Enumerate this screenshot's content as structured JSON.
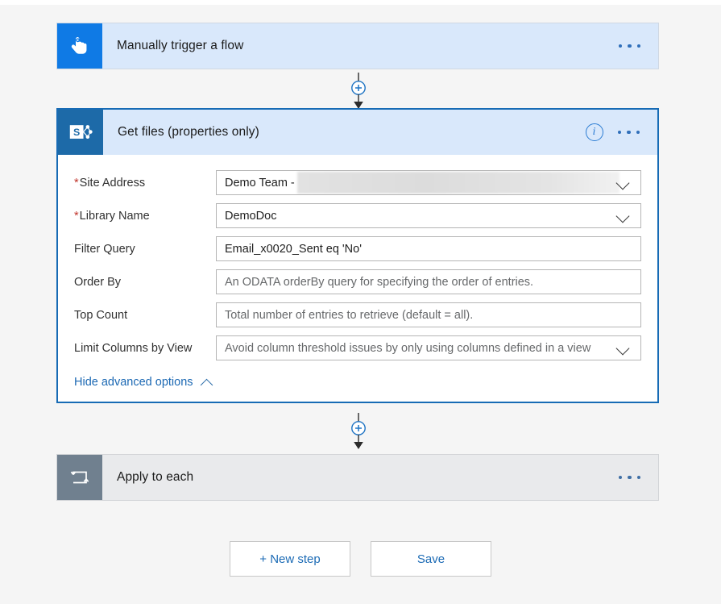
{
  "flow": {
    "trigger": {
      "title": "Manually trigger a flow",
      "icon": "tap-hand-icon",
      "icon_color": "#0f7ae5",
      "header_color": "#d9e8fb",
      "menu_label": "..."
    },
    "action": {
      "title": "Get files (properties only)",
      "icon": "sharepoint-icon",
      "icon_color": "#1d6aa8",
      "header_color": "#d9e8fb",
      "border_color": "#176bb5",
      "selected": true,
      "info_label": "i",
      "menu_label": "...",
      "fields": [
        {
          "label": "Site Address",
          "required": true,
          "value": "Demo Team -",
          "redacted": true,
          "type": "dropdown"
        },
        {
          "label": "Library Name",
          "required": true,
          "value": "DemoDoc",
          "redacted": false,
          "type": "dropdown"
        },
        {
          "label": "Filter Query",
          "required": false,
          "value": "Email_x0020_Sent eq 'No'",
          "redacted": false,
          "type": "text"
        },
        {
          "label": "Order By",
          "required": false,
          "placeholder": "An ODATA orderBy query for specifying the order of entries.",
          "redacted": false,
          "type": "text"
        },
        {
          "label": "Top Count",
          "required": false,
          "placeholder": "Total number of entries to retrieve (default = all).",
          "redacted": false,
          "type": "text"
        },
        {
          "label": "Limit Columns by View",
          "required": false,
          "placeholder": "Avoid column threshold issues by only using columns defined in a view",
          "redacted": false,
          "type": "dropdown"
        }
      ],
      "advanced_options_label": "Hide advanced options"
    },
    "loop": {
      "title": "Apply to each",
      "icon": "loop-icon",
      "icon_color": "#70808f",
      "header_color": "#e9eaec",
      "menu_label": "..."
    },
    "connectors": [
      {
        "icon": "plus-in-circle-icon",
        "color": "#1f74c4"
      },
      {
        "icon": "plus-in-circle-icon",
        "color": "#1f74c4"
      }
    ]
  },
  "footer": {
    "new_step_label": "+ New step",
    "save_label": "Save",
    "link_color": "#1c6bb5"
  }
}
